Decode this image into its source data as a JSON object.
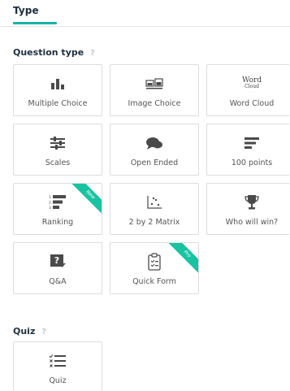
{
  "tabs": {
    "active": "Type"
  },
  "question_type": {
    "title": "Question type",
    "help": "?",
    "items": [
      {
        "label": "Multiple Choice"
      },
      {
        "label": "Image Choice"
      },
      {
        "label": "Word Cloud",
        "icon_words": [
          "Word",
          "Cloud"
        ]
      },
      {
        "label": "Scales"
      },
      {
        "label": "Open Ended"
      },
      {
        "label": "100 points"
      },
      {
        "label": "Ranking",
        "badge": "New",
        "rank_numbers": [
          "1",
          "2",
          "3"
        ]
      },
      {
        "label": "2 by 2 Matrix"
      },
      {
        "label": "Who will win?"
      },
      {
        "label": "Q&A",
        "icon_text": "?"
      },
      {
        "label": "Quick Form",
        "badge": "Pro"
      }
    ]
  },
  "quiz": {
    "title": "Quiz",
    "help": "?",
    "items": [
      {
        "label": "Quiz"
      }
    ]
  },
  "colors": {
    "accent": "#1ab3a6",
    "ribbon": "#17c3a0",
    "icon": "#4a4a4a"
  }
}
